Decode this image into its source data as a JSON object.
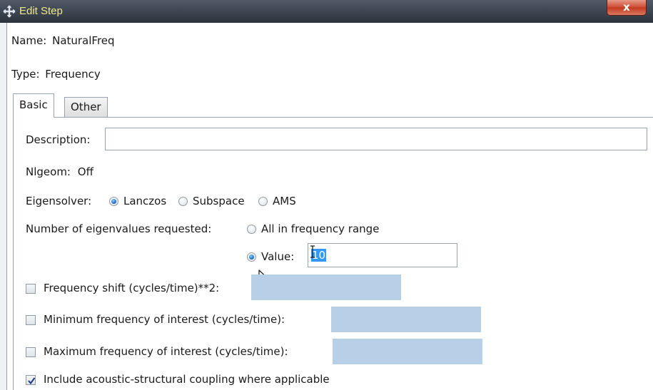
{
  "window": {
    "title": "Edit Step",
    "close_glyph": "x"
  },
  "step": {
    "name_label": "Name:",
    "name_value": "NaturalFreq",
    "type_label": "Type:",
    "type_value": "Frequency"
  },
  "tabs": [
    {
      "label": "Basic",
      "active": true
    },
    {
      "label": "Other",
      "active": false
    }
  ],
  "basic": {
    "description_label": "Description:",
    "description_value": "",
    "nlgeom_label": "Nlgeom:",
    "nlgeom_value": "Off",
    "eigensolver_label": "Eigensolver:",
    "eigensolver_options": [
      {
        "label": "Lanczos",
        "selected": true
      },
      {
        "label": "Subspace",
        "selected": false
      },
      {
        "label": "AMS",
        "selected": false
      }
    ],
    "num_eigen_label": "Number of eigenvalues requested:",
    "all_in_range_label": "All in frequency range",
    "value_label": "Value:",
    "value_input": "10",
    "freq_shift_label": "Frequency shift (cycles/time)**2:",
    "freq_shift_checked": false,
    "min_freq_label": "Minimum frequency of interest (cycles/time):",
    "min_freq_checked": false,
    "max_freq_label": "Maximum frequency of interest (cycles/time):",
    "max_freq_checked": false,
    "acoustic_label": "Include acoustic-structural coupling where applicable",
    "acoustic_checked": true
  },
  "colors": {
    "title_text": "#f0e88b",
    "selection": "#3399ff",
    "disabled_field": "#b8cfe8"
  }
}
